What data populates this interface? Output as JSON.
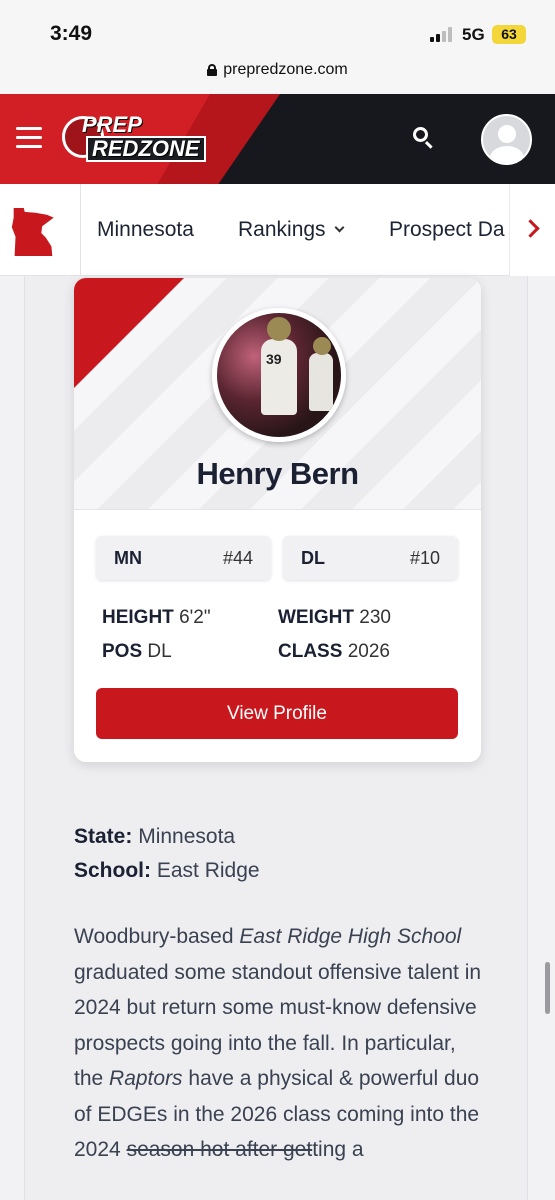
{
  "status_bar": {
    "time": "3:49",
    "network": "5G",
    "battery": "63"
  },
  "browser": {
    "url": "prepredzone.com"
  },
  "header": {
    "logo_line1": "PREP",
    "logo_line2": "REDZONE"
  },
  "state_nav": {
    "items": [
      {
        "label": "Minnesota"
      },
      {
        "label": "Rankings"
      },
      {
        "label": "Prospect Da"
      }
    ]
  },
  "card": {
    "name": "Henry Bern",
    "photo_jersey": "39",
    "rank_state": {
      "label": "MN",
      "value": "#44"
    },
    "rank_position": {
      "label": "DL",
      "value": "#10"
    },
    "stats": {
      "height_label": "HEIGHT",
      "height_value": "6'2\"",
      "weight_label": "WEIGHT",
      "weight_value": "230",
      "pos_label": "POS",
      "pos_value": "DL",
      "class_label": "CLASS",
      "class_value": "2026"
    },
    "button_label": "View Profile"
  },
  "info": {
    "state_label": "State:",
    "state_value": "Minnesota",
    "school_label": "School:",
    "school_value": "East Ridge"
  },
  "article": {
    "p1_a": "Woodbury-based ",
    "p1_school": "East Ridge High School",
    "p1_b": " graduated some standout offensive talent in 2024 but return some must-know defensive prospects going into the fall. In particular, the ",
    "p1_team": "Raptors",
    "p1_c": " have a physical & powerful duo of EDGEs in the 2026 class coming into the 2024 ",
    "p1_strike": "season hot after get",
    "p1_d": "ting a"
  },
  "colors": {
    "brand_red": "#c8181e",
    "header_bg": "#16181d"
  }
}
